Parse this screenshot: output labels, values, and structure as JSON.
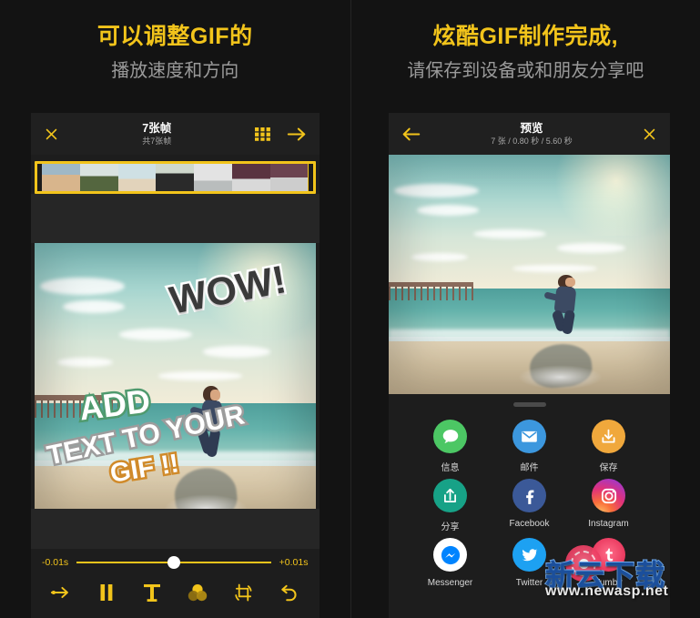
{
  "left": {
    "heading": "可以调整GIF的",
    "subheading": "播放速度和方向",
    "topbar": {
      "close_icon": "close-icon",
      "title": "7张帧",
      "subtitle": "共7张帧",
      "grid_icon": "grid-icon",
      "next_icon": "arrow-right-icon"
    },
    "slider": {
      "min_label": "-0.01s",
      "max_label": "+0.01s",
      "value_percent": 50
    },
    "tools": [
      {
        "name": "direction-icon",
        "label": "方向"
      },
      {
        "name": "pause-icon",
        "label": "暂停"
      },
      {
        "name": "text-icon",
        "label": "文字"
      },
      {
        "name": "filter-icon",
        "label": "滤镜"
      },
      {
        "name": "crop-rotate-icon",
        "label": "裁剪"
      },
      {
        "name": "undo-icon",
        "label": "撤销"
      }
    ],
    "overlay_texts": [
      {
        "text": "WOW!",
        "style": "wow"
      },
      {
        "text": "ADD",
        "style": "add"
      },
      {
        "text": "TEXT TO YOUR",
        "style": "t2yours"
      },
      {
        "text": "GIF !!",
        "style": "gif"
      }
    ]
  },
  "right": {
    "heading": "炫酷GIF制作完成,",
    "subheading": "请保存到设备或和朋友分享吧",
    "topbar": {
      "back_icon": "arrow-left-icon",
      "title": "预览",
      "subtitle": "7 张 / 0.80 秒 / 5.60 秒",
      "close_icon": "close-icon"
    },
    "share": [
      {
        "label": "信息",
        "icon": "message-icon",
        "color": "#4CC764"
      },
      {
        "label": "邮件",
        "icon": "mail-icon",
        "color": "#3C97DE"
      },
      {
        "label": "保存",
        "icon": "download-icon",
        "color": "#F0A83C"
      },
      {
        "label": "分享",
        "icon": "share-icon",
        "color": "#17A287"
      },
      {
        "label": "Facebook",
        "icon": "facebook-icon",
        "color": "#3B5998"
      },
      {
        "label": "Instagram",
        "icon": "instagram-icon",
        "color": "#C13584"
      },
      {
        "label": "Messenger",
        "icon": "messenger-icon",
        "color": "#0084FF"
      },
      {
        "label": "Twitter",
        "icon": "twitter-icon",
        "color": "#1DA1F2"
      },
      {
        "label": "Tumblr",
        "icon": "tumblr-icon",
        "color": "#E8365C"
      }
    ]
  },
  "watermark": {
    "main": "新云下载",
    "sub": "www.newasp.net"
  },
  "colors": {
    "accent": "#F2C41B",
    "background": "#131313",
    "panel": "#1d1d1d",
    "topbar": "#202020",
    "muted_text": "#9a9a9a"
  }
}
